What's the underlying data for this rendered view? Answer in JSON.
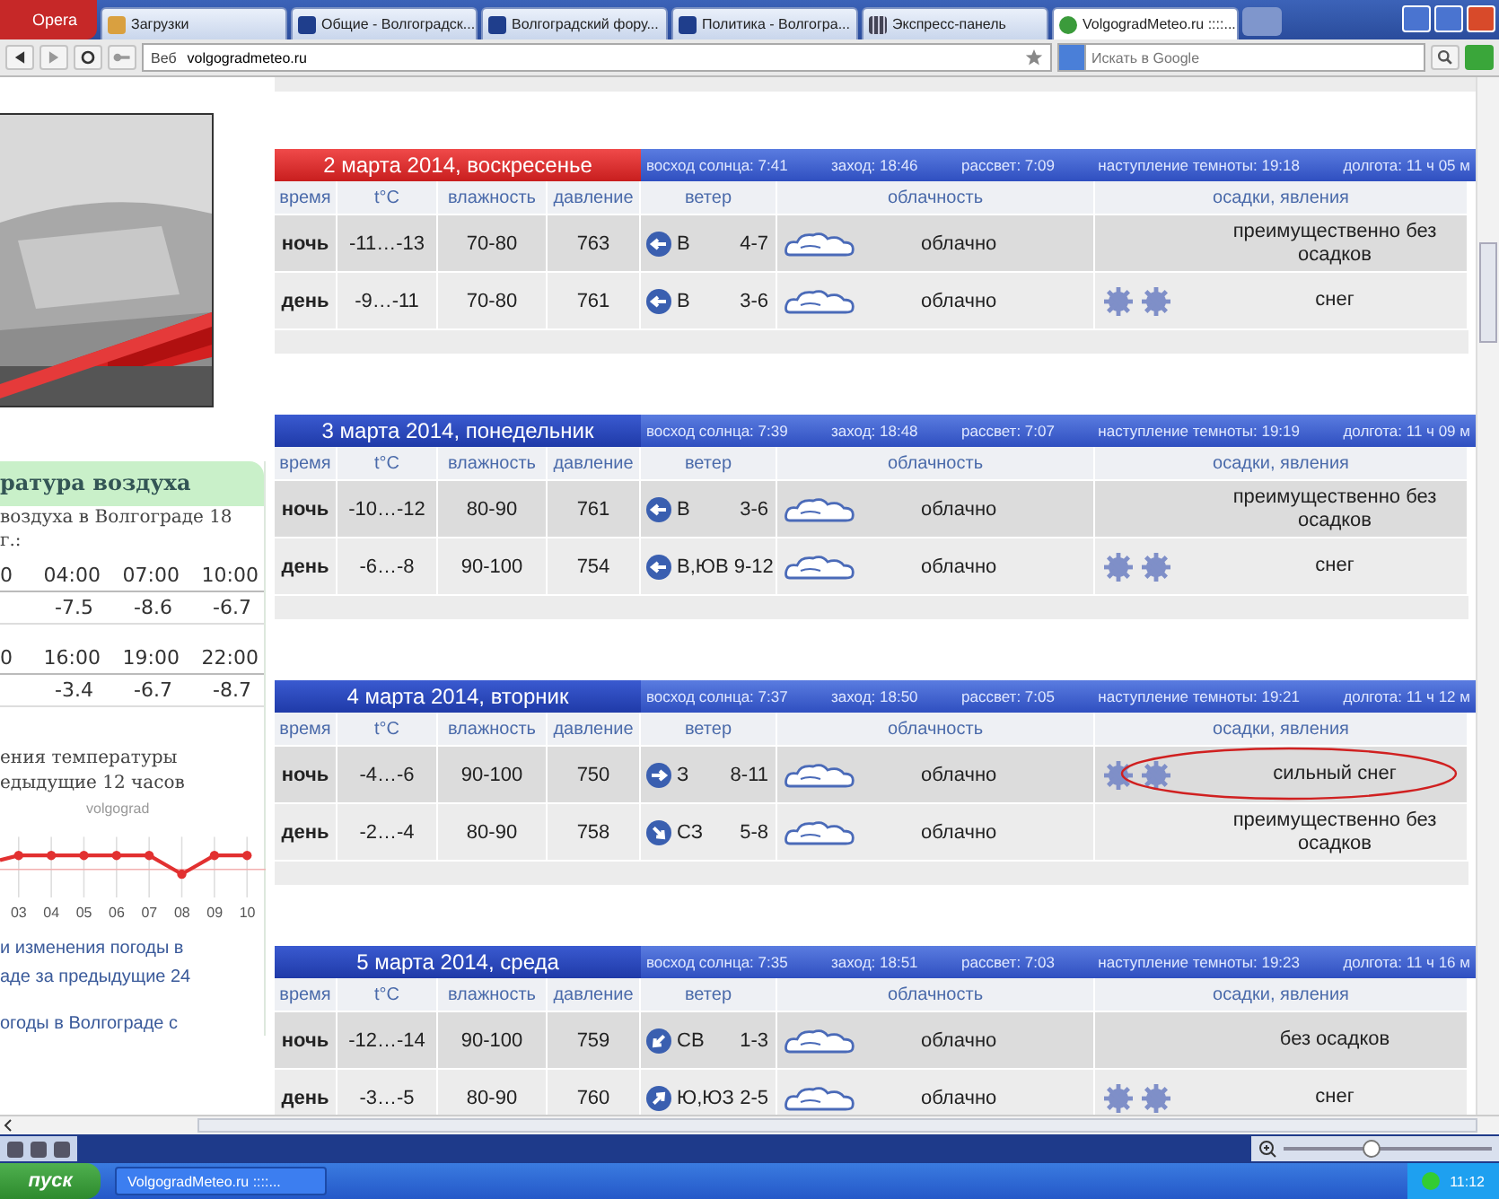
{
  "browser": {
    "opera_button": "Opera",
    "tabs": [
      {
        "label": "Загрузки",
        "selected": false
      },
      {
        "label": "Общие - Волгоградск...",
        "selected": false
      },
      {
        "label": "Волгоградский фору...",
        "selected": false
      },
      {
        "label": "Политика - Волгогра...",
        "selected": false
      },
      {
        "label": "Экспресс-панель",
        "selected": false
      },
      {
        "label": "VolgogradMeteo.ru ::::...",
        "selected": true
      }
    ],
    "address": {
      "scheme": "Веб",
      "url": "volgogradmeteo.ru"
    },
    "search": {
      "placeholder": "Искать в Google"
    }
  },
  "sidebar": {
    "banner": {
      "kind": "picture"
    },
    "temperature": {
      "title": "ратура воздуха",
      "caption_lines": [
        "воздуха в Волгограде 18",
        "г.:"
      ],
      "rows": [
        {
          "times": [
            "0",
            "04:00",
            "07:00",
            "10:00"
          ],
          "values": [
            "-7.5",
            "-8.6",
            "-6.7"
          ]
        },
        {
          "times": [
            "0",
            "16:00",
            "19:00",
            "22:00"
          ],
          "values": [
            "-3.4",
            "-6.7",
            "-8.7"
          ]
        }
      ]
    },
    "chart": {
      "title_lines": [
        "ения температуры",
        "едыдущие 12 часов"
      ],
      "watermark": "volgograd",
      "x_labels": [
        "03",
        "04",
        "05",
        "06",
        "07",
        "08",
        "09",
        "10"
      ]
    },
    "links": [
      "и изменения погоды в",
      "аде за предыдущие 24",
      "огоды в Волгограде с"
    ]
  },
  "days": [
    {
      "title": "2 марта 2014, воскресенье",
      "weekend": true,
      "circled": false,
      "sun": [
        "восход солнца: 7:41",
        "заход: 18:46",
        "рассвет: 7:09",
        "наступление темноты: 19:18",
        "долгота: 11 ч 05 м"
      ],
      "columns": [
        "время",
        "t°C",
        "влажность",
        "давление",
        "ветер",
        "облачность",
        "осадки, явления"
      ],
      "rows": [
        {
          "time": "ночь",
          "temp": "-11…-13",
          "humidity": "70-80",
          "pressure": "763",
          "wind_dir": "В",
          "kind": "west",
          "wind_speed": "4-7",
          "cloud": "облачно",
          "snow": false,
          "precip": "преимущественно без осадков"
        },
        {
          "time": "день",
          "temp": "-9…-11",
          "humidity": "70-80",
          "pressure": "761",
          "wind_dir": "В",
          "kind": "west",
          "wind_speed": "3-6",
          "cloud": "облачно",
          "snow": true,
          "precip": "снег"
        }
      ]
    },
    {
      "title": "3 марта 2014, понедельник",
      "weekend": false,
      "circled": false,
      "sun": [
        "восход солнца: 7:39",
        "заход: 18:48",
        "рассвет: 7:07",
        "наступление темноты: 19:19",
        "долгота: 11 ч 09 м"
      ],
      "columns": [
        "время",
        "t°C",
        "влажность",
        "давление",
        "ветер",
        "облачность",
        "осадки, явления"
      ],
      "rows": [
        {
          "time": "ночь",
          "temp": "-10…-12",
          "humidity": "80-90",
          "pressure": "761",
          "wind_dir": "В",
          "kind": "west",
          "wind_speed": "3-6",
          "cloud": "облачно",
          "snow": false,
          "precip": "преимущественно без осадков"
        },
        {
          "time": "день",
          "temp": "-6…-8",
          "humidity": "90-100",
          "pressure": "754",
          "wind_dir": "В,ЮВ",
          "kind": "west",
          "wind_speed": "9-12",
          "cloud": "облачно",
          "snow": true,
          "precip": "снег"
        }
      ]
    },
    {
      "title": "4 марта 2014, вторник",
      "weekend": false,
      "circled": true,
      "sun": [
        "восход солнца: 7:37",
        "заход: 18:50",
        "рассвет: 7:05",
        "наступление темноты: 19:21",
        "долгота: 11 ч 12 м"
      ],
      "columns": [
        "время",
        "t°C",
        "влажность",
        "давление",
        "ветер",
        "облачность",
        "осадки, явления"
      ],
      "rows": [
        {
          "time": "ночь",
          "temp": "-4…-6",
          "humidity": "90-100",
          "pressure": "750",
          "wind_dir": "З",
          "kind": "east",
          "wind_speed": "8-11",
          "cloud": "облачно",
          "snow": true,
          "precip": "сильный снег"
        },
        {
          "time": "день",
          "temp": "-2…-4",
          "humidity": "80-90",
          "pressure": "758",
          "wind_dir": "СЗ",
          "kind": "southeast",
          "wind_speed": "5-8",
          "cloud": "облачно",
          "snow": false,
          "precip": "преимущественно без осадков"
        }
      ]
    },
    {
      "title": "5 марта 2014, среда",
      "weekend": false,
      "circled": false,
      "sun": [
        "восход солнца: 7:35",
        "заход: 18:51",
        "рассвет: 7:03",
        "наступление темноты: 19:23",
        "долгота: 11 ч 16 м"
      ],
      "columns": [
        "время",
        "t°C",
        "влажность",
        "давление",
        "ветер",
        "облачность",
        "осадки, явления"
      ],
      "rows": [
        {
          "time": "ночь",
          "temp": "-12…-14",
          "humidity": "90-100",
          "pressure": "759",
          "wind_dir": "СВ",
          "kind": "southwest",
          "wind_speed": "1-3",
          "cloud": "облачно",
          "snow": false,
          "precip": "без осадков"
        },
        {
          "time": "день",
          "temp": "-3…-5",
          "humidity": "80-90",
          "pressure": "760",
          "wind_dir": "Ю,ЮЗ",
          "kind": "northeast",
          "wind_speed": "2-5",
          "cloud": "облачно",
          "snow": true,
          "precip": "снег"
        }
      ]
    }
  ],
  "zoom": {
    "level": 0.42
  },
  "taskbar": {
    "start": "пуск",
    "window": "VolgogradMeteo.ru ::::...",
    "clock": "11:12"
  }
}
